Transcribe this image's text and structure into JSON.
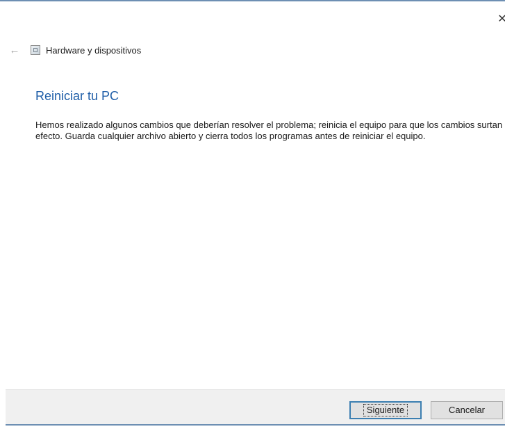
{
  "window": {
    "close_glyph": "✕"
  },
  "header": {
    "back_glyph": "←",
    "title": "Hardware y dispositivos"
  },
  "main": {
    "title": "Reiniciar tu PC",
    "body": "Hemos realizado algunos cambios que deberían resolver el problema; reinicia el equipo para que los cambios surtan efecto.  Guarda cualquier archivo abierto y cierra todos los programas antes de reiniciar el equipo."
  },
  "footer": {
    "next_label": "Siguiente",
    "cancel_label": "Cancelar"
  },
  "colors": {
    "accent_title": "#1f5ea8",
    "window_border": "#6d8fb3",
    "default_button_border": "#3c7fb1"
  }
}
